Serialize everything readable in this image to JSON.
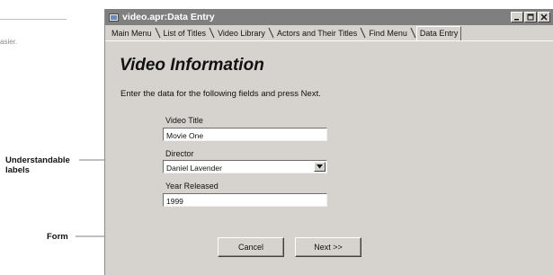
{
  "margin": {
    "fragment_text": "asier.",
    "callouts": {
      "labels": "Understandable labels",
      "form": "Form"
    }
  },
  "window": {
    "title": "video.apr:Data Entry",
    "icons": {
      "app": "window-app-icon",
      "minimize": "minimize-icon",
      "maximize": "maximize-icon",
      "close": "close-icon"
    },
    "tabs": [
      {
        "label": "Main Menu",
        "active": false
      },
      {
        "label": "List of Titles",
        "active": false
      },
      {
        "label": "Video Library",
        "active": false
      },
      {
        "label": "Actors and Their Titles",
        "active": false
      },
      {
        "label": "Find Menu",
        "active": false
      },
      {
        "label": "Data Entry",
        "active": true
      }
    ]
  },
  "form": {
    "heading": "Video Information",
    "instructions": "Enter the data for the following fields and press Next.",
    "fields": {
      "video_title": {
        "label": "Video Title",
        "value": "Movie One"
      },
      "director": {
        "label": "Director",
        "value": "Daniel Lavender"
      },
      "year_released": {
        "label": "Year Released",
        "value": "1999"
      }
    },
    "buttons": {
      "cancel": "Cancel",
      "next": "Next >>"
    }
  },
  "colors": {
    "window_bg": "#d6d3ce",
    "titlebar_bg": "#7f7f7f",
    "field_bg": "#ffffff"
  }
}
